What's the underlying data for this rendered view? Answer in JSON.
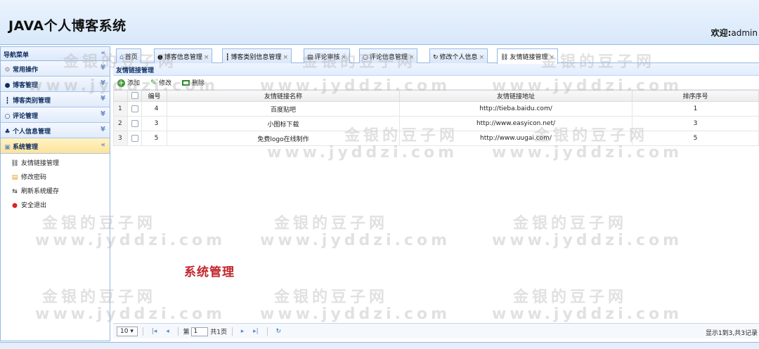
{
  "header": {
    "app_title": "JAVA个人博客系统",
    "welcome_label": "欢迎:",
    "username": "admin"
  },
  "sidebar": {
    "title": "导航菜单",
    "sections": [
      {
        "label": "常用操作",
        "icon": "gear-icon"
      },
      {
        "label": "博客管理",
        "icon": "blog-icon"
      },
      {
        "label": "博客类别管理",
        "icon": "category-icon"
      },
      {
        "label": "评论管理",
        "icon": "comment-icon"
      },
      {
        "label": "个人信息管理",
        "icon": "user-icon"
      },
      {
        "label": "系统管理",
        "icon": "system-icon"
      }
    ],
    "sub_items": [
      {
        "label": "友情链接管理",
        "icon": "link-icon"
      },
      {
        "label": "修改密码",
        "icon": "key-icon"
      },
      {
        "label": "刷新系统缓存",
        "icon": "refresh-icon"
      },
      {
        "label": "安全退出",
        "icon": "exit-icon"
      }
    ]
  },
  "tabs": [
    {
      "label": "首页",
      "icon": "home-icon"
    },
    {
      "label": "博客信息管理",
      "icon": "blog-icon"
    },
    {
      "label": "博客类别信息管理",
      "icon": "category-icon"
    },
    {
      "label": "评论审核",
      "icon": "review-icon"
    },
    {
      "label": "评论信息管理",
      "icon": "comment-icon"
    },
    {
      "label": "修改个人信息",
      "icon": "refresh-icon"
    },
    {
      "label": "友情链接管理",
      "icon": "link-icon"
    }
  ],
  "panel": {
    "title": "友情链接管理",
    "toolbar": {
      "add": "添加",
      "edit": "修改",
      "delete": "删除"
    }
  },
  "table": {
    "columns": [
      "编号",
      "友情链接名称",
      "友情链接地址",
      "排序序号"
    ],
    "rows": [
      {
        "rownum": "1",
        "id": "4",
        "name": "百度贴吧",
        "url": "http://tieba.baidu.com/",
        "order": "1"
      },
      {
        "rownum": "2",
        "id": "3",
        "name": "小图标下载",
        "url": "http://www.easyicon.net/",
        "order": "3"
      },
      {
        "rownum": "3",
        "id": "5",
        "name": "免费logo在线制作",
        "url": "http://www.uugai.com/",
        "order": "5"
      }
    ]
  },
  "pager": {
    "page_size": "10 ▾",
    "page_label_before": "第",
    "page_value": "1",
    "page_label_after": "共1页",
    "info": "显示1到3,共3记录"
  },
  "overlay_text": "系统管理",
  "watermark": {
    "line1": "金银的豆子网",
    "line2": "www.jyddzi.com"
  },
  "colors": {
    "accent": "#95b8e7",
    "active_menu": "#fde39b",
    "overlay": "#c1272d"
  }
}
